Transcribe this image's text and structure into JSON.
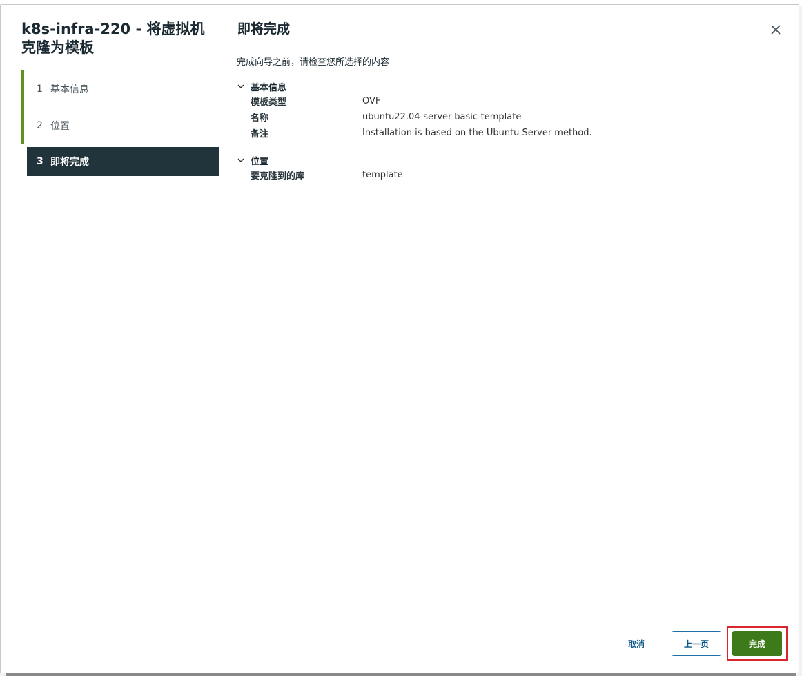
{
  "wizard": {
    "title": "k8s-infra-220 - 将虚拟机克隆为模板",
    "steps": [
      {
        "num": "1",
        "label": "基本信息"
      },
      {
        "num": "2",
        "label": "位置"
      },
      {
        "num": "3",
        "label": "即将完成"
      }
    ],
    "active_step": 3
  },
  "page": {
    "title": "即将完成",
    "intro": "完成向导之前，请检查您所选择的内容"
  },
  "sections": {
    "basic": {
      "title": "基本信息",
      "rows": [
        {
          "key": "模板类型",
          "value": "OVF"
        },
        {
          "key": "名称",
          "value": "ubuntu22.04-server-basic-template"
        },
        {
          "key": "备注",
          "value": "Installation is based on the Ubuntu Server method."
        }
      ]
    },
    "location": {
      "title": "位置",
      "rows": [
        {
          "key": "要克隆到的库",
          "value": "template"
        }
      ]
    }
  },
  "footer": {
    "cancel": "取消",
    "back": "上一页",
    "finish": "完成"
  },
  "colors": {
    "accent_green": "#3d7a1a",
    "active_step_bg": "#21333b",
    "link_blue": "#0d5a8a",
    "highlight_red": "#d8262c"
  },
  "icons": {
    "close": "close-icon",
    "chevron": "chevron-down-icon"
  }
}
